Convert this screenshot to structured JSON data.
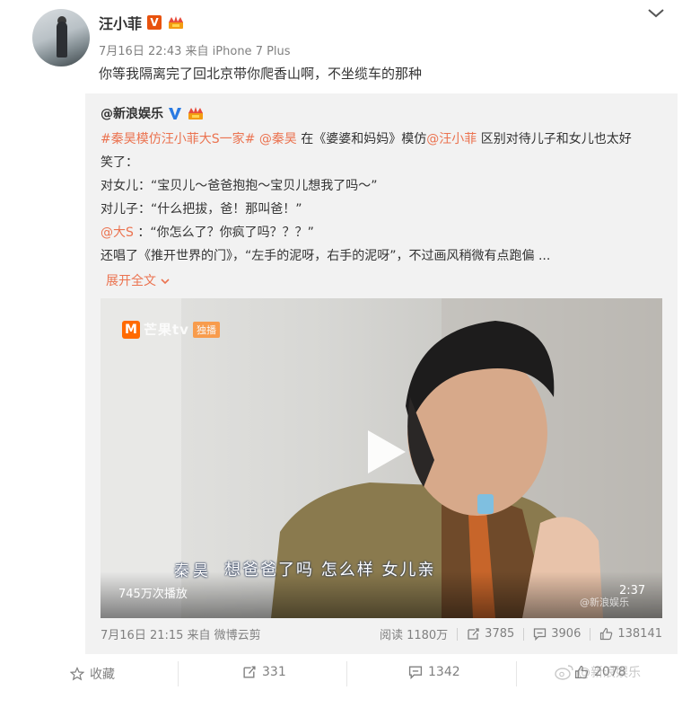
{
  "post": {
    "author": "汪小菲",
    "meta": "7月16日 22:43 来自 iPhone 7 Plus",
    "text": "你等我隔离完了回北京带你爬香山啊，不坐缆车的那种"
  },
  "repost": {
    "author": "@新浪娱乐",
    "line1": {
      "tags": "#秦昊模仿汪小菲大S一家#",
      "mention_qinhao": "@秦昊",
      "mid": "在《婆婆和妈妈》模仿",
      "mention_wang": "@汪小菲",
      "tail": "区别对待儿子和女儿也太好"
    },
    "line2": "笑了：",
    "line3": "对女儿：“宝贝儿～爸爸抱抱～宝贝儿想我了吗～”",
    "line4": "对儿子：“什么把拔，爸！那叫爸！”",
    "line5": {
      "mention": "@大S",
      "text": "：“你怎么了？你疯了吗？？？”"
    },
    "line6": "还唱了《推开世界的门》，“左手的泥呀，右手的泥呀”，不过画风稍微有点跑偏 ...",
    "expand": "展开全文",
    "video": {
      "logo_text": "芒果tv",
      "logo_tag": "独播",
      "subtitle_name": "秦昊",
      "subtitle_text": "想爸爸了吗 怎么样 女儿亲",
      "plays": "745万次播放",
      "duration": "2:37",
      "watermark": "@新浪娱乐"
    },
    "footer": {
      "source": "7月16日 21:15 来自 微博云剪",
      "reads": "阅读 1180万",
      "reposts": "3785",
      "comments": "3906",
      "likes": "138141"
    }
  },
  "actions": {
    "favorite": "收藏",
    "repost": "331",
    "comment": "1342",
    "like": "2078"
  },
  "watermark": "@新浪娱乐",
  "colors": {
    "link": "#eb7350",
    "verified_orange": "#e8520e",
    "meta_gray": "#808080"
  }
}
